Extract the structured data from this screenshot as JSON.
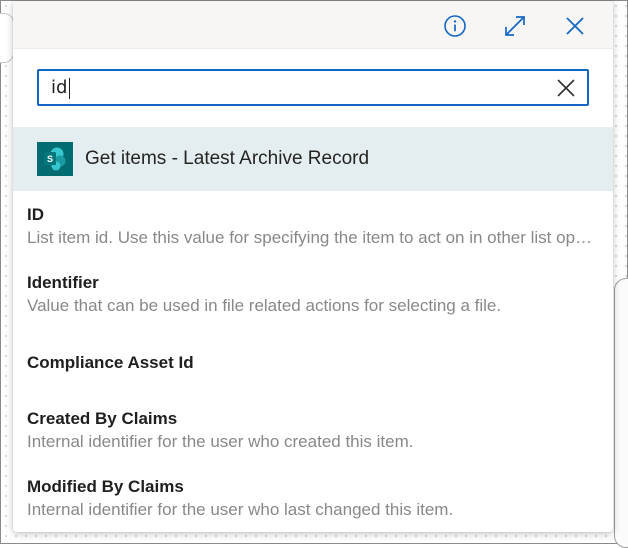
{
  "header": {
    "info_icon": "info-icon",
    "expand_icon": "expand-icon",
    "close_icon": "close-icon",
    "accent_color": "#1366c4"
  },
  "search": {
    "value": "id",
    "placeholder": "",
    "clear_icon": "close-icon"
  },
  "group": {
    "icon": "sharepoint-icon",
    "icon_letter": "S",
    "icon_color": "#036c70",
    "title": "Get items - Latest Archive Record"
  },
  "items": [
    {
      "title": "ID",
      "description": "List item id. Use this value for specifying the item to act on in other list operations."
    },
    {
      "title": "Identifier",
      "description": "Value that can be used in file related actions for selecting a file."
    },
    {
      "title": "Compliance Asset Id",
      "description": ""
    },
    {
      "title": "Created By Claims",
      "description": "Internal identifier for the user who created this item."
    },
    {
      "title": "Modified By Claims",
      "description": "Internal identifier for the user who last changed this item."
    }
  ]
}
